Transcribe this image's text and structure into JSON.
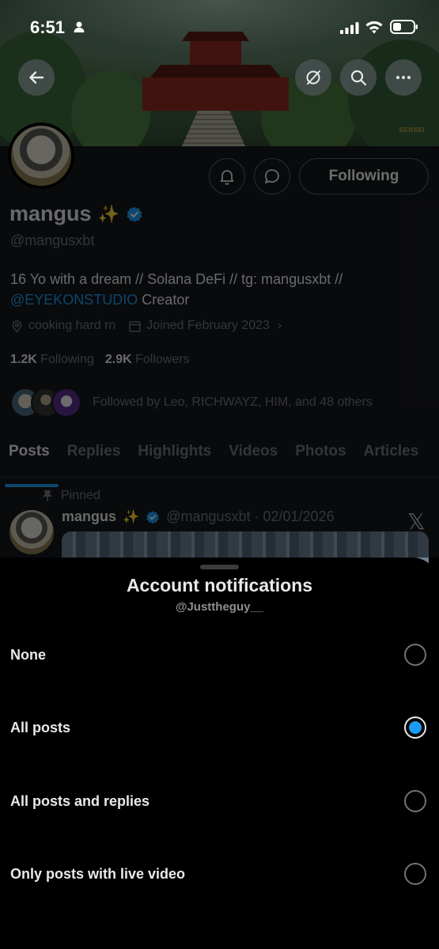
{
  "status_bar": {
    "time": "6:51"
  },
  "banner": {
    "tag": "SENSEI"
  },
  "profile": {
    "following_label": "Following",
    "display_name": "mangus",
    "sparkle": "✨",
    "handle": "@mangusxbt",
    "bio_text": "16 Yo with a dream // Solana DeFi // tg: mangusxbt //",
    "bio_link": "@EYEKONSTUDIO",
    "bio_suffix": " Creator",
    "location": "cooking hard rn",
    "joined": "Joined February 2023",
    "following_count": "1.2K",
    "following_label_text": "Following",
    "followers_count": "2.9K",
    "followers_label_text": "Followers",
    "followed_by": "Followed by Leo, RICHWAYZ, HIM, and 48 others"
  },
  "tabs": [
    "Posts",
    "Replies",
    "Highlights",
    "Videos",
    "Photos",
    "Articles"
  ],
  "post": {
    "pinned_label": "Pinned",
    "name": "mangus",
    "sparkle": "✨",
    "meta": "@mangusxbt · 02/01/2026",
    "x_logo": "𝕏"
  },
  "sheet": {
    "title": "Account notifications",
    "subtitle": "@Justtheguy__",
    "options": [
      {
        "label": "None",
        "selected": false
      },
      {
        "label": "All posts",
        "selected": true
      },
      {
        "label": "All posts and replies",
        "selected": false
      },
      {
        "label": "Only posts with live video",
        "selected": false
      }
    ]
  },
  "colors": {
    "accent": "#1d9bf0",
    "background": "#000000",
    "muted": "#71767b"
  }
}
